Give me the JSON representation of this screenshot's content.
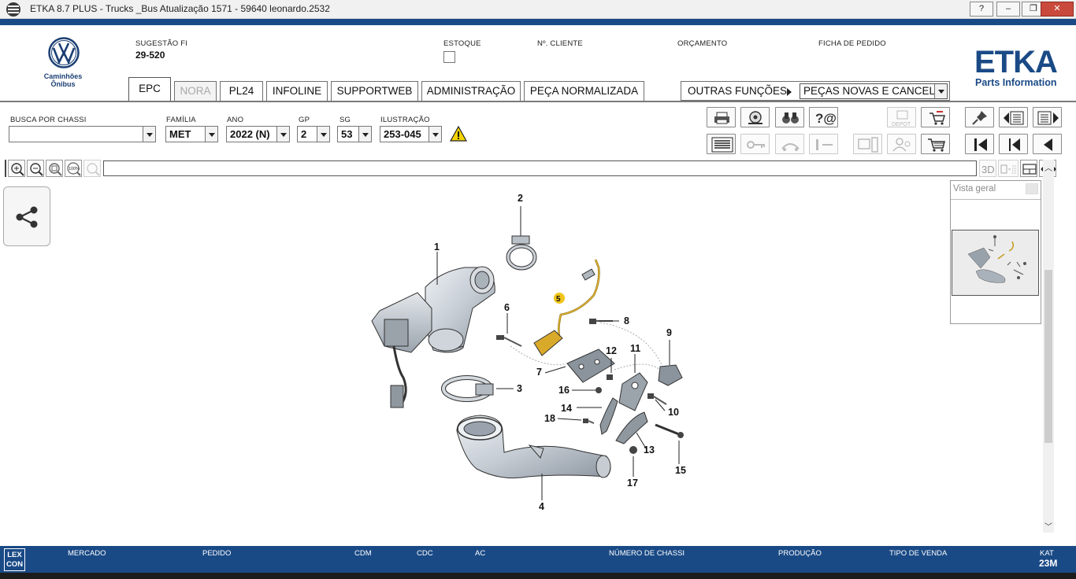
{
  "window": {
    "title": "ETKA 8.7 PLUS - Trucks _Bus Atualização 1571 - 59640 leonardo.2532",
    "controls": {
      "help": "?",
      "minimize": "–",
      "restore": "❐",
      "close": "✕"
    }
  },
  "brand": {
    "sub_line1": "Caminhões",
    "sub_line2": "Ônibus",
    "etka": "ETKA",
    "etka_sub": "Parts Information"
  },
  "header": {
    "sugestao_label": "SUGESTÃO FI",
    "sugestao_value": "29-520",
    "estoque_label": "ESTOQUE",
    "cliente_label": "Nº. CLIENTE",
    "orcamento_label": "ORÇAMENTO",
    "ficha_label": "FICHA DE PEDIDO"
  },
  "tabs": [
    {
      "label": "EPC"
    },
    {
      "label": "NORA"
    },
    {
      "label": "PL24"
    },
    {
      "label": "INFOLINE"
    },
    {
      "label": "SUPPORTWEB"
    },
    {
      "label": "ADMINISTRAÇÃO"
    },
    {
      "label": "PEÇA NORMALIZADA"
    }
  ],
  "outras": {
    "label": "OUTRAS FUNÇÕES",
    "selected": "PEÇAS NOVAS E CANCEL."
  },
  "filters": {
    "chassi_label": "BUSCA POR CHASSI",
    "chassi_value": "",
    "familia_label": "FAMÍLIA",
    "familia_value": "MET",
    "ano_label": "ANO",
    "ano_value": "2022 (N)",
    "gp_label": "GP",
    "gp_value": "2",
    "sg_label": "SG",
    "sg_value": "53",
    "ilustracao_label": "ILUSTRAÇÃO",
    "ilustracao_value": "253-045"
  },
  "toolbar": {
    "depot_label": "DEPOT",
    "btn_3d": "3D",
    "zoom_100": "100%"
  },
  "diagram": {
    "labels": [
      "1",
      "2",
      "3",
      "4",
      "5",
      "6",
      "7",
      "8",
      "9",
      "10",
      "11",
      "12",
      "13",
      "14",
      "15",
      "16",
      "17",
      "18"
    ],
    "highlight": "5",
    "highlight_color": "#f0c419"
  },
  "overview": {
    "title": "Vista geral"
  },
  "status": {
    "lexcon_line1": "LEX",
    "lexcon_line2": "CON",
    "mercado": "MERCADO",
    "pedido": "PEDIDO",
    "cdm": "CDM",
    "cdc": "CDC",
    "ac": "AC",
    "numero_chassi": "NÚMERO DE CHASSI",
    "producao": "PRODUÇÃO",
    "tipo_venda": "TIPO DE VENDA",
    "kat_label": "KAT",
    "kat_value": "23M"
  },
  "colors": {
    "accent": "#1a4a86",
    "close": "#c94a3c"
  }
}
